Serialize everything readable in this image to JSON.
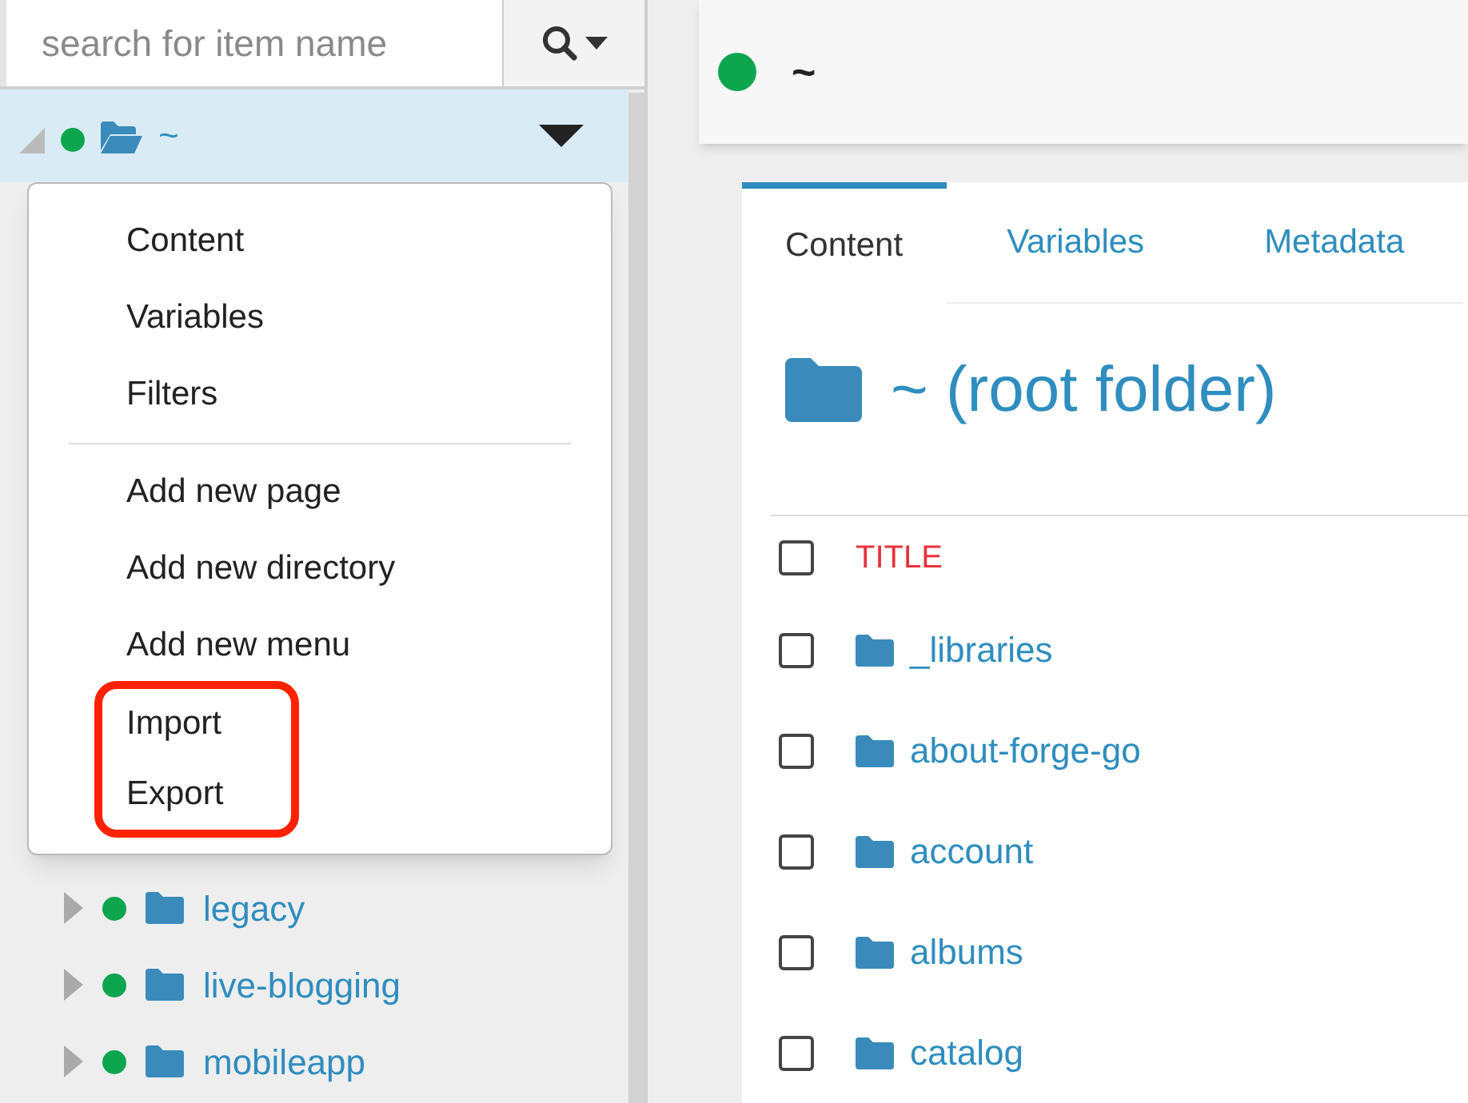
{
  "search": {
    "placeholder": "search for item name"
  },
  "tree_root": {
    "label": "~",
    "expanded": true,
    "selected": true,
    "color": "#0ea54f"
  },
  "context_menu": {
    "groups": [
      [
        {
          "label": "Content",
          "highlighted": false
        },
        {
          "label": "Variables",
          "highlighted": false
        },
        {
          "label": "Filters",
          "highlighted": false
        }
      ],
      [
        {
          "label": "Add new page",
          "highlighted": false
        },
        {
          "label": "Add new directory",
          "highlighted": false
        },
        {
          "label": "Add new menu",
          "highlighted": false
        },
        {
          "label": "Import",
          "highlighted": true
        },
        {
          "label": "Export",
          "highlighted": true
        }
      ]
    ]
  },
  "tree_items": [
    {
      "label": "legacy",
      "expanded": false,
      "color": "#0ea54f"
    },
    {
      "label": "live-blogging",
      "expanded": false,
      "color": "#0ea54f"
    },
    {
      "label": "mobileapp",
      "expanded": false,
      "color": "#0ea54f"
    }
  ],
  "header": {
    "title": "~",
    "color": "#0ea54f"
  },
  "tabs": [
    {
      "label": "Content",
      "selected": true
    },
    {
      "label": "Variables",
      "selected": false
    },
    {
      "label": "Metadata",
      "selected": false
    }
  ],
  "page_title": "~ (root folder)",
  "table": {
    "all_checked": false,
    "columns": [
      "TITLE"
    ],
    "rows": [
      {
        "title": "_libraries",
        "checked": false
      },
      {
        "title": "about-forge-go",
        "checked": false
      },
      {
        "title": "account",
        "checked": false
      },
      {
        "title": "albums",
        "checked": false
      },
      {
        "title": "catalog",
        "checked": false
      }
    ]
  }
}
